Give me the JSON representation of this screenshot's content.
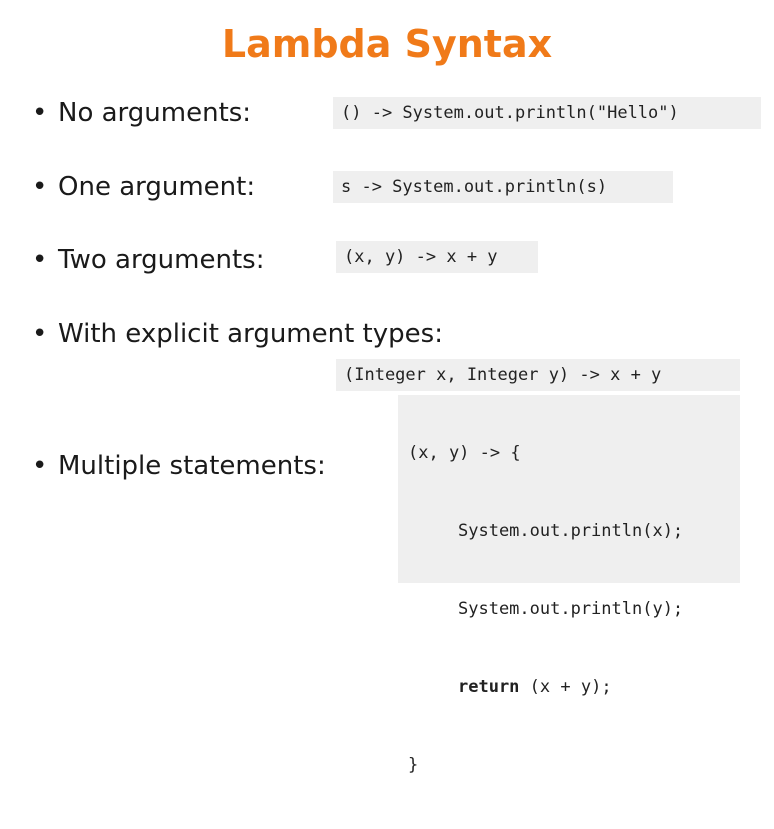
{
  "slide": {
    "title": "Lambda Syntax",
    "bullet_glyph": "•"
  },
  "items": [
    {
      "label": "No arguments:",
      "code": "() -> System.out.println(\"Hello\")"
    },
    {
      "label": "One argument:",
      "code": "s -> System.out.println(s)"
    },
    {
      "label": "Two arguments:",
      "code": "(x, y) -> x + y"
    },
    {
      "label": "With explicit argument types:",
      "code": "(Integer x, Integer y) -> x + y"
    },
    {
      "label": "Multiple statements:",
      "code_lines": [
        "(x, y) -> {",
        "System.out.println(x);",
        "System.out.println(y);",
        "(x + y);",
        "}"
      ],
      "keyword": "return"
    }
  ]
}
